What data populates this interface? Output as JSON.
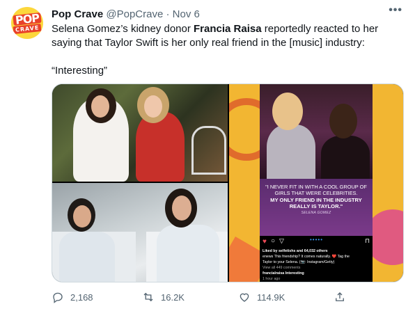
{
  "tweet": {
    "author_name": "Pop Crave",
    "handle": "@PopCrave",
    "separator": "·",
    "date": "Nov 6",
    "avatar_text_top": "POP",
    "avatar_text_bottom": "CRAVE",
    "text_part1": "Selena Gomez’s kidney donor ",
    "text_bold": "Francia Raisa",
    "text_part2": " reportedly reacted to her saying that Taylor Swift is her only real friend in the [music] industry:",
    "quote": "“Interesting”",
    "more_label": "•••"
  },
  "instagram_card": {
    "quote_line1": "\"I NEVER FIT IN WITH A COOL GROUP OF GIRLS THAT WERE CELEBRITIES.",
    "quote_line2": "MY ONLY FRIEND IN THE INDUSTRY REALLY IS TAYLOR.\"",
    "quote_attribution": "SELENA GOMEZ",
    "likes_line": "Liked by selfetishs and 64,032 others",
    "caption_line1": "enews This friendship? It comes naturally. ❤️ Tag the",
    "caption_line2": "Taylor to your Selena. (📷: Instagram/Getty)",
    "comments_line": "View all 449 comments",
    "reply_line": "francialraisa Interesting",
    "time_line": "1 hour ago"
  },
  "stats": {
    "replies": "2,168",
    "retweets": "16.2K",
    "likes": "114.9K"
  },
  "icons": {
    "reply": "reply-icon",
    "retweet": "retweet-icon",
    "like": "heart-icon",
    "share": "share-icon"
  }
}
